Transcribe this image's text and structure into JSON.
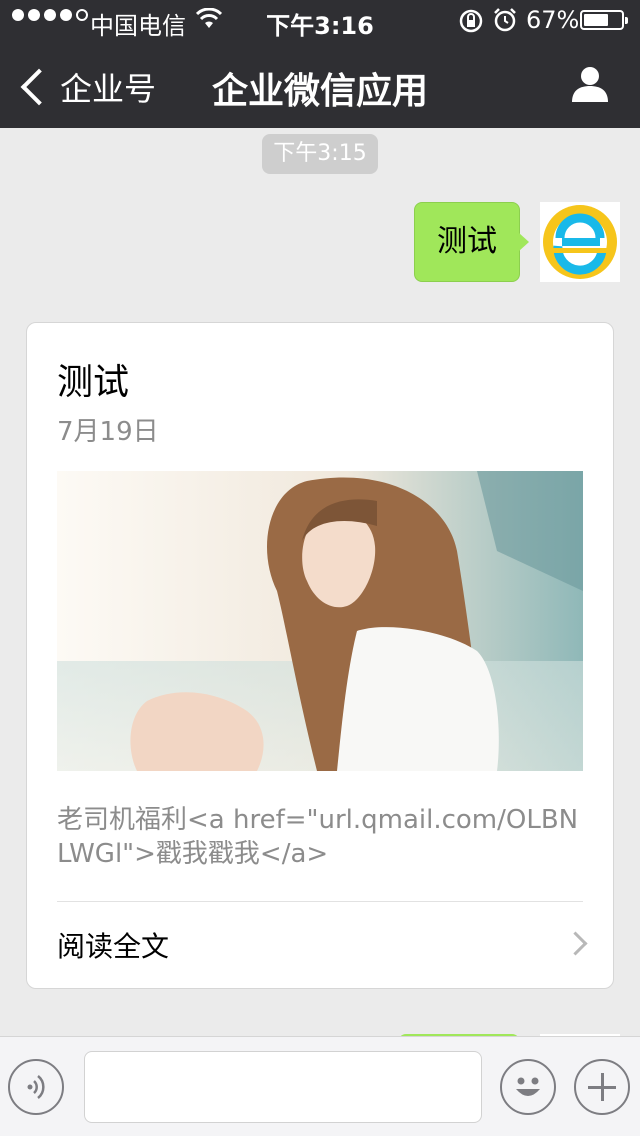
{
  "status_bar": {
    "carrier": "中国电信",
    "time": "下午3:16",
    "battery_percent": "67%",
    "battery_level": 0.67,
    "signal_bars_filled": 4,
    "signal_bars_total": 5,
    "icons": [
      "wifi-icon",
      "rotation-lock-icon",
      "alarm-icon",
      "battery-icon"
    ]
  },
  "nav": {
    "back_label": "企业号",
    "title": "企业微信应用",
    "right_icon": "person-icon"
  },
  "chat": {
    "timestamp": "下午3:15",
    "sent_message": "测试",
    "avatar_icon": "enterprise-logo-icon"
  },
  "article_card": {
    "title": "测试",
    "date": "7月19日",
    "image_alt": "photo-of-woman",
    "description": "老司机福利<a href=\"url.qmail.com/OLBNLWGl\">戳我戳我</a>",
    "read_more": "阅读全文"
  },
  "input_bar": {
    "voice_icon": "voice-icon",
    "text_value": "",
    "emoji_icon": "emoji-icon",
    "plus_icon": "plus-icon"
  },
  "colors": {
    "nav_bg": "#2f2f33",
    "chat_bg": "#ebebeb",
    "bubble_green": "#a0e75a",
    "timestamp_bg": "#cecece"
  }
}
